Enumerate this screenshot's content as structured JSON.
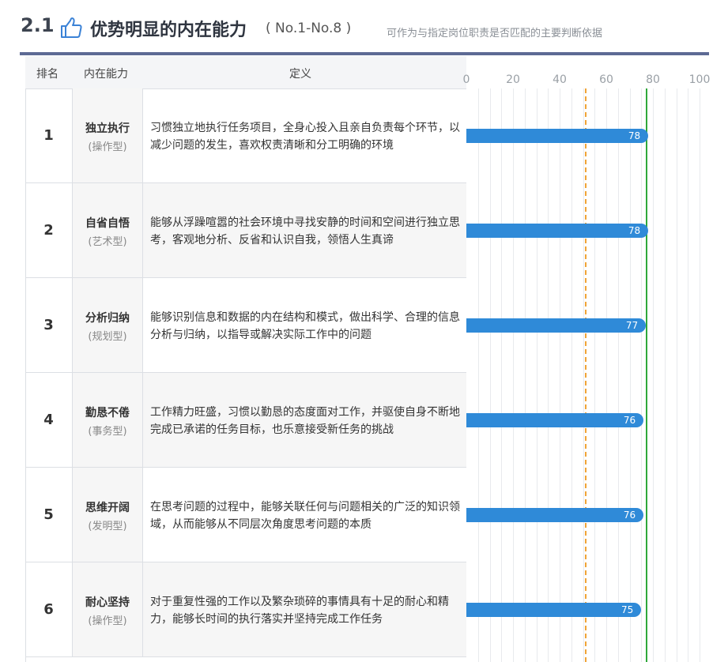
{
  "header": {
    "section_no": "2.1",
    "title": "优势明显的内在能力",
    "range": "( No.1-No.8 )",
    "note": "可作为与指定岗位职责是否匹配的主要判断依据"
  },
  "table": {
    "col_rank": "排名",
    "col_ability": "内在能力",
    "col_definition": "定义",
    "rows": [
      {
        "rank": "1",
        "name": "独立执行",
        "type": "(操作型)",
        "definition": "习惯独立地执行任务项目，全身心投入且亲自负责每个环节，以减少问题的发生，喜欢权责清晰和分工明确的环境",
        "score": "78"
      },
      {
        "rank": "2",
        "name": "自省自悟",
        "type": "(艺术型)",
        "definition": "能够从浮躁喧嚣的社会环境中寻找安静的时间和空间进行独立思考，客观地分析、反省和认识自我，领悟人生真谛",
        "score": "78"
      },
      {
        "rank": "3",
        "name": "分析归纳",
        "type": "(规划型)",
        "definition": "能够识别信息和数据的内在结构和模式，做出科学、合理的信息分析与归纳，以指导或解决实际工作中的问题",
        "score": "77"
      },
      {
        "rank": "4",
        "name": "勤恳不倦",
        "type": "(事务型)",
        "definition": "工作精力旺盛，习惯以勤恳的态度面对工作，并驱使自身不断地完成已承诺的任务目标，也乐意接受新任务的挑战",
        "score": "76"
      },
      {
        "rank": "5",
        "name": "思维开阔",
        "type": "(发明型)",
        "definition": "在思考问题的过程中，能够关联任何与问题相关的广泛的知识领域，从而能够从不同层次角度思考问题的本质",
        "score": "76"
      },
      {
        "rank": "6",
        "name": "耐心坚持",
        "type": "(操作型)",
        "definition": "对于重复性强的工作以及繁杂琐碎的事情具有十足的耐心和精力，能够长时间的执行落实并坚持完成工作任务",
        "score": "75"
      }
    ]
  },
  "chart_data": {
    "type": "bar",
    "orientation": "horizontal",
    "categories": [
      "独立执行",
      "自省自悟",
      "分析归纳",
      "勤恳不倦",
      "思维开阔",
      "耐心坚持"
    ],
    "values": [
      78,
      78,
      77,
      76,
      76,
      75
    ],
    "xlim": [
      0,
      100
    ],
    "xticks": [
      "0",
      "20",
      "40",
      "60",
      "80",
      "100"
    ],
    "reference_lines": [
      {
        "value": 51,
        "style": "dashed",
        "color": "#f0a437"
      },
      {
        "value": 77,
        "style": "solid",
        "color": "#2fa83a"
      }
    ],
    "bar_color": "#2f8ad8",
    "grid": true
  },
  "colors": {
    "accent": "#5d6a94",
    "thumb": "#3b82d6"
  }
}
